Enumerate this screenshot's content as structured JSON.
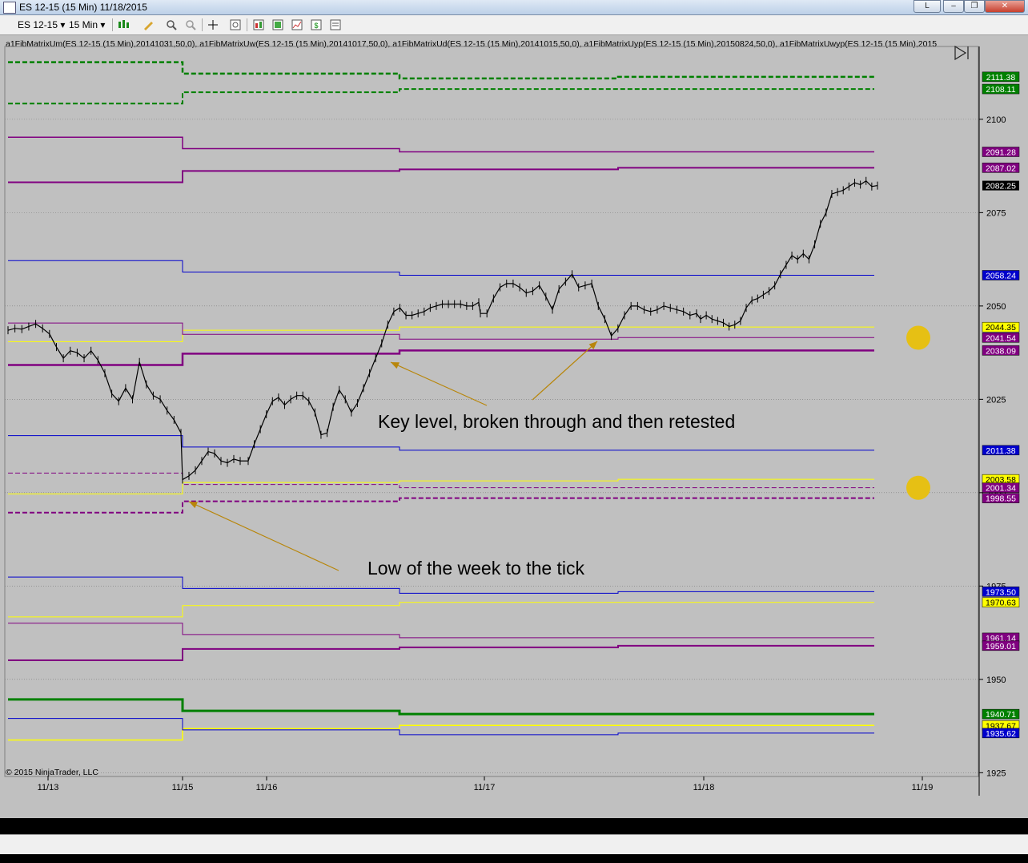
{
  "window": {
    "title": "ES 12-15 (15 Min)  11/18/2015",
    "controls": [
      "L",
      "–",
      "❐",
      "✕"
    ]
  },
  "toolbar": {
    "instrument": "ES 12-15",
    "interval": "15 Min"
  },
  "indicator_label": "a1FibMatrixUm(ES 12-15 (15 Min),20141031,50,0), a1FibMatrixUw(ES 12-15 (15 Min),20141017,50,0), a1FibMatrixUd(ES 12-15 (15 Min),20141015,50,0), a1FibMatrixUyp(ES 12-15 (15 Min),20150824,50,0), a1FibMatrixUwyp(ES 12-15 (15 Min),2015",
  "copyright": "© 2015 NinjaTrader, LLC",
  "colors": {
    "background": "#c0c0c0",
    "green": "#008000",
    "purple": "#800080",
    "blue": "#0000cc",
    "yellow": "#ffff00",
    "annotation": "#b8860b",
    "dot": "#e6c014"
  },
  "chart_data": {
    "type": "line",
    "title": "ES 12-15 (15 Min)",
    "x_ticks": [
      "11/13",
      "11/15",
      "11/16",
      "11/17",
      "11/18",
      "11/19"
    ],
    "y_ticks": [
      1925.0,
      1950.0,
      1975.0,
      2000.0,
      2025.0,
      2050.0,
      2075.0,
      2100.0
    ],
    "ylim": [
      1924.0,
      2119.5
    ],
    "grid": true,
    "last_price": 2082.25,
    "price_series": [
      [
        "11/13",
        2043.5
      ],
      [
        "11/13",
        2044.0
      ],
      [
        "11/13",
        2043.8
      ],
      [
        "11/13",
        2044.5
      ],
      [
        "11/13",
        2045.2
      ],
      [
        "11/13",
        2044.0
      ],
      [
        "11/13",
        2042.5
      ],
      [
        "11/13",
        2039.0
      ],
      [
        "11/13",
        2036.0
      ],
      [
        "11/13",
        2038.0
      ],
      [
        "11/13",
        2037.5
      ],
      [
        "11/13",
        2036.0
      ],
      [
        "11/13",
        2038.0
      ],
      [
        "11/13",
        2035.5
      ],
      [
        "11/13",
        2032.0
      ],
      [
        "11/13",
        2026.5
      ],
      [
        "11/13",
        2024.5
      ],
      [
        "11/13",
        2028.0
      ],
      [
        "11/13",
        2025.0
      ],
      [
        "11/13",
        2035.0
      ],
      [
        "11/13",
        2029.0
      ],
      [
        "11/13",
        2026.0
      ],
      [
        "11/13",
        2025.0
      ],
      [
        "11/13",
        2022.0
      ],
      [
        "11/13",
        2019.5
      ],
      [
        "11/13",
        2016.0
      ],
      [
        "11/15",
        2003.5
      ],
      [
        "11/15",
        2004.5
      ],
      [
        "11/15",
        2006.0
      ],
      [
        "11/15",
        2008.5
      ],
      [
        "11/15",
        2011.0
      ],
      [
        "11/15",
        2010.5
      ],
      [
        "11/15",
        2008.5
      ],
      [
        "11/15",
        2008.0
      ],
      [
        "11/15",
        2009.0
      ],
      [
        "11/15",
        2008.5
      ],
      [
        "11/16",
        2008.5
      ],
      [
        "11/16",
        2013.0
      ],
      [
        "11/16",
        2017.0
      ],
      [
        "11/16",
        2021.0
      ],
      [
        "11/16",
        2024.5
      ],
      [
        "11/16",
        2025.5
      ],
      [
        "11/16",
        2023.5
      ],
      [
        "11/16",
        2025.0
      ],
      [
        "11/16",
        2026.0
      ],
      [
        "11/16",
        2026.0
      ],
      [
        "11/16",
        2024.5
      ],
      [
        "11/16",
        2021.5
      ],
      [
        "11/16",
        2015.5
      ],
      [
        "11/16",
        2016.0
      ],
      [
        "11/16",
        2023.0
      ],
      [
        "11/16",
        2027.5
      ],
      [
        "11/16",
        2025.0
      ],
      [
        "11/16",
        2021.5
      ],
      [
        "11/16",
        2024.0
      ],
      [
        "11/16",
        2028.0
      ],
      [
        "11/16",
        2032.0
      ],
      [
        "11/16",
        2036.0
      ],
      [
        "11/16",
        2040.0
      ],
      [
        "11/16",
        2045.0
      ],
      [
        "11/16",
        2048.5
      ],
      [
        "11/16",
        2049.5
      ],
      [
        "11/16",
        2047.5
      ],
      [
        "11/16",
        2047.5
      ],
      [
        "11/16",
        2048.0
      ],
      [
        "11/16",
        2048.5
      ],
      [
        "11/16",
        2049.5
      ],
      [
        "11/16",
        2050.0
      ],
      [
        "11/16",
        2050.5
      ],
      [
        "11/16",
        2050.5
      ],
      [
        "11/16",
        2050.5
      ],
      [
        "11/16",
        2050.5
      ],
      [
        "11/16",
        2050.0
      ],
      [
        "11/16",
        2050.0
      ],
      [
        "11/16",
        2051.0
      ],
      [
        "11/17",
        2048.0
      ],
      [
        "11/17",
        2048.0
      ],
      [
        "11/17",
        2052.0
      ],
      [
        "11/17",
        2055.0
      ],
      [
        "11/17",
        2056.0
      ],
      [
        "11/17",
        2056.0
      ],
      [
        "11/17",
        2055.0
      ],
      [
        "11/17",
        2053.5
      ],
      [
        "11/17",
        2054.0
      ],
      [
        "11/17",
        2055.5
      ],
      [
        "11/17",
        2052.5
      ],
      [
        "11/17",
        2049.0
      ],
      [
        "11/17",
        2054.5
      ],
      [
        "11/17",
        2056.5
      ],
      [
        "11/17",
        2058.5
      ],
      [
        "11/17",
        2055.0
      ],
      [
        "11/17",
        2055.5
      ],
      [
        "11/17",
        2056.0
      ],
      [
        "11/17",
        2050.0
      ],
      [
        "11/17",
        2046.5
      ],
      [
        "11/17",
        2042.0
      ],
      [
        "11/17",
        2044.0
      ],
      [
        "11/17",
        2047.5
      ],
      [
        "11/17",
        2050.0
      ],
      [
        "11/17",
        2050.0
      ],
      [
        "11/17",
        2049.0
      ],
      [
        "11/17",
        2048.5
      ],
      [
        "11/17",
        2049.0
      ],
      [
        "11/17",
        2050.0
      ],
      [
        "11/17",
        2049.5
      ],
      [
        "11/17",
        2049.0
      ],
      [
        "11/17",
        2048.5
      ],
      [
        "11/17",
        2047.5
      ],
      [
        "11/17",
        2048.0
      ],
      [
        "11/18",
        2046.5
      ],
      [
        "11/18",
        2047.5
      ],
      [
        "11/18",
        2046.5
      ],
      [
        "11/18",
        2046.0
      ],
      [
        "11/18",
        2045.5
      ],
      [
        "11/18",
        2044.5
      ],
      [
        "11/18",
        2045.0
      ],
      [
        "11/18",
        2046.0
      ],
      [
        "11/18",
        2049.5
      ],
      [
        "11/18",
        2051.5
      ],
      [
        "11/18",
        2052.0
      ],
      [
        "11/18",
        2053.0
      ],
      [
        "11/18",
        2054.0
      ],
      [
        "11/18",
        2055.5
      ],
      [
        "11/18",
        2058.5
      ],
      [
        "11/18",
        2061.0
      ],
      [
        "11/18",
        2063.5
      ],
      [
        "11/18",
        2062.5
      ],
      [
        "11/18",
        2064.0
      ],
      [
        "11/18",
        2062.5
      ],
      [
        "11/18",
        2066.5
      ],
      [
        "11/18",
        2072.0
      ],
      [
        "11/18",
        2075.0
      ],
      [
        "11/18",
        2080.0
      ],
      [
        "11/18",
        2080.5
      ],
      [
        "11/18",
        2081.0
      ],
      [
        "11/18",
        2082.0
      ],
      [
        "11/18",
        2083.0
      ],
      [
        "11/18",
        2082.5
      ],
      [
        "11/18",
        2083.5
      ],
      [
        "11/18",
        2082.0
      ],
      [
        "11/18",
        2082.25
      ]
    ],
    "levels": [
      {
        "price": 2111.38,
        "label": "2111.38",
        "color": "#008000",
        "style": "dashed",
        "width": 2.5
      },
      {
        "price": 2108.11,
        "label": "2108.11",
        "color": "#008000",
        "style": "dashed",
        "width": 2
      },
      {
        "price": 2091.28,
        "label": "2091.28",
        "color": "#800080",
        "style": "solid",
        "width": 1.5
      },
      {
        "price": 2087.02,
        "label": "2087.02",
        "color": "#800080",
        "style": "solid",
        "width": 2
      },
      {
        "price": 2058.24,
        "label": "2058.24",
        "color": "#0000cc",
        "style": "solid",
        "width": 1
      },
      {
        "price": 2044.35,
        "label": "2044.35",
        "color": "#ffff00",
        "style": "solid",
        "width": 1
      },
      {
        "price": 2041.54,
        "label": "2041.54",
        "color": "#800080",
        "style": "solid",
        "width": 1
      },
      {
        "price": 2038.09,
        "label": "2038.09",
        "color": "#800080",
        "style": "solid",
        "width": 2.5
      },
      {
        "price": 2011.38,
        "label": "2011.38",
        "color": "#0000cc",
        "style": "solid",
        "width": 1
      },
      {
        "price": 2003.58,
        "label": "2003.58",
        "color": "#ffff00",
        "style": "solid",
        "width": 1
      },
      {
        "price": 2001.34,
        "label": "2001.34",
        "color": "#800080",
        "style": "dashed",
        "width": 1
      },
      {
        "price": 1998.55,
        "label": "1998.55",
        "color": "#800080",
        "style": "dashed",
        "width": 2
      },
      {
        "price": 1973.5,
        "label": "1973.50",
        "color": "#0000cc",
        "style": "solid",
        "width": 1
      },
      {
        "price": 1970.63,
        "label": "1970.63",
        "color": "#ffff00",
        "style": "solid",
        "width": 1
      },
      {
        "price": 1961.14,
        "label": "1961.14",
        "color": "#800080",
        "style": "solid",
        "width": 1
      },
      {
        "price": 1959.01,
        "label": "1959.01",
        "color": "#800080",
        "style": "solid",
        "width": 2
      },
      {
        "price": 1940.71,
        "label": "1940.71",
        "color": "#008000",
        "style": "solid",
        "width": 3
      },
      {
        "price": 1937.67,
        "label": "1937.67",
        "color": "#ffff00",
        "style": "solid",
        "width": 1.5
      },
      {
        "price": 1935.62,
        "label": "1935.62",
        "color": "#0000cc",
        "style": "solid",
        "width": 1
      }
    ],
    "annotations": [
      {
        "text": "Key level, broken through and then retested"
      },
      {
        "text": "Low of the week to the tick"
      }
    ]
  }
}
